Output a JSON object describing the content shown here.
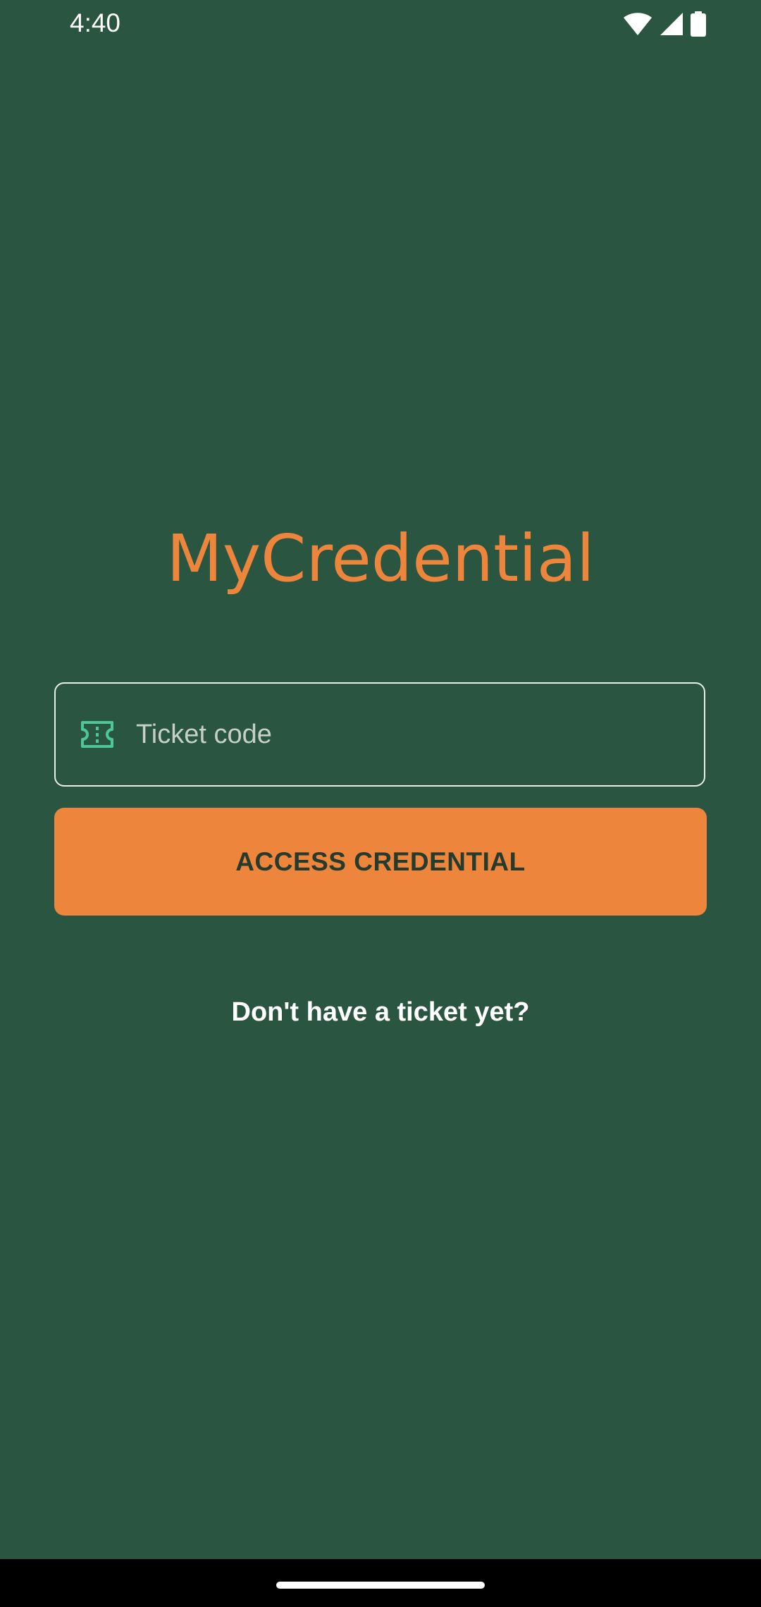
{
  "status_bar": {
    "time": "4:40",
    "icons": [
      "wifi-icon",
      "cellular-signal-icon",
      "battery-icon"
    ]
  },
  "app": {
    "title": "MyCredential"
  },
  "ticket_field": {
    "icon": "ticket-icon",
    "placeholder": "Ticket code",
    "value": ""
  },
  "actions": {
    "access_label": "ACCESS CREDENTIAL",
    "no_ticket_label": "Don't have a ticket yet?"
  },
  "colors": {
    "background": "#295541",
    "accent": "#ee853c",
    "icon_accent": "#4cc79a",
    "button_text": "#243b2e",
    "text_light": "#ffffff"
  }
}
